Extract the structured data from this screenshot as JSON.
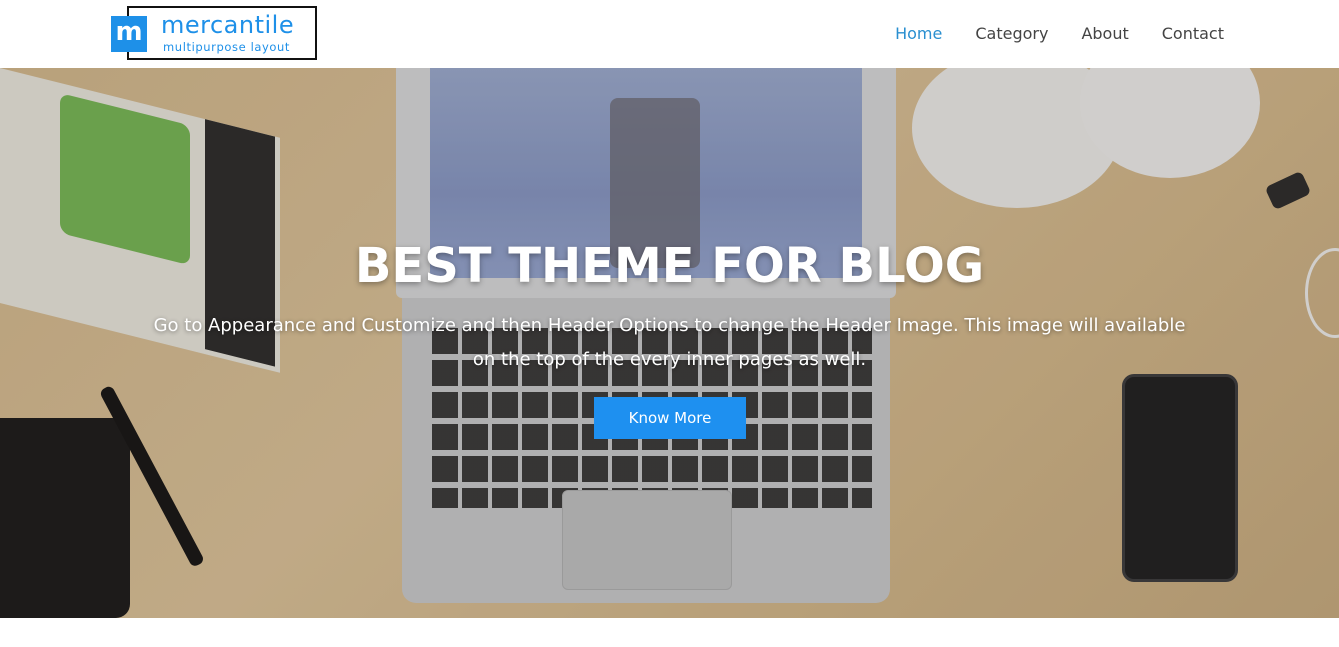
{
  "brand": {
    "logo_letter": "m",
    "name": "mercantile",
    "tagline": "multipurpose layout",
    "color": "#1e90e8"
  },
  "nav": {
    "items": [
      {
        "label": "Home",
        "active": true
      },
      {
        "label": "Category",
        "active": false
      },
      {
        "label": "About",
        "active": false
      },
      {
        "label": "Contact",
        "active": false
      }
    ],
    "active_color": "#2a8fd0"
  },
  "hero": {
    "title": "BEST THEME FOR BLOG",
    "description": "Go to Appearance and Customize and then Header Options to change the Header Image. This image will available on the top of the every inner pages as well.",
    "button_label": "Know More",
    "button_color": "#1e90f0"
  }
}
